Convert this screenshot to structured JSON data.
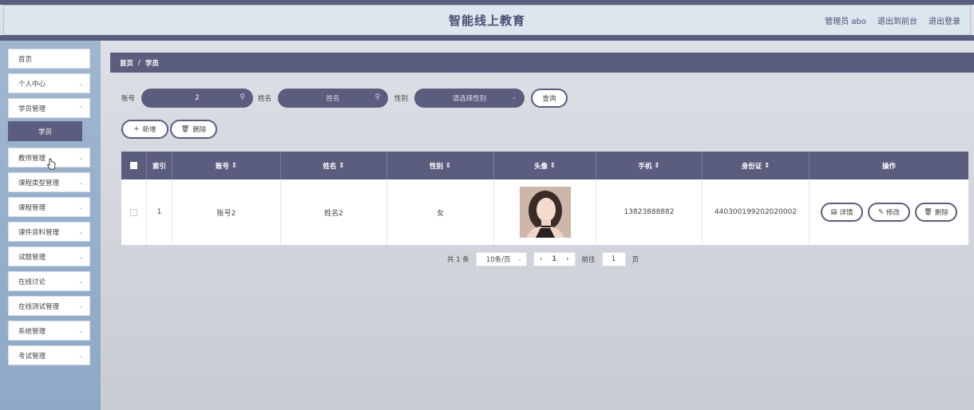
{
  "app": {
    "title": "智能线上教育",
    "user_label": "管理员 abo",
    "to_front": "退出到前台",
    "logout": "退出登录"
  },
  "sidebar": {
    "items": [
      {
        "label": "首页",
        "has_chevron": false
      },
      {
        "label": "个人中心",
        "has_chevron": true
      },
      {
        "label": "学员管理",
        "has_chevron": true
      },
      {
        "label": "教师管理",
        "has_chevron": true
      },
      {
        "label": "课程类型管理",
        "has_chevron": true
      },
      {
        "label": "课程管理",
        "has_chevron": true
      },
      {
        "label": "课件资料管理",
        "has_chevron": true
      },
      {
        "label": "试题管理",
        "has_chevron": true
      },
      {
        "label": "在线讨论",
        "has_chevron": true
      },
      {
        "label": "在线测试管理",
        "has_chevron": true
      },
      {
        "label": "系统管理",
        "has_chevron": true
      },
      {
        "label": "考试管理",
        "has_chevron": true
      }
    ],
    "sub_active": "学员"
  },
  "breadcrumb": {
    "home": "首页",
    "sep": "/",
    "current": "学员"
  },
  "search": {
    "account_label": "账号",
    "account_value": "2",
    "name_label": "姓名",
    "name_placeholder": "姓名",
    "gender_label": "性别",
    "gender_placeholder": "请选择性别",
    "query_button": "查询"
  },
  "actions": {
    "add": "新增",
    "delete": "删除"
  },
  "table": {
    "headers": [
      "索引",
      "账号",
      "姓名",
      "性别",
      "头像",
      "手机",
      "身份证",
      "操作"
    ],
    "rows": [
      {
        "index": "1",
        "account": "账号2",
        "name": "姓名2",
        "gender": "女",
        "phone": "13823888882",
        "id_card": "440300199202020002",
        "btn_detail": "详情",
        "btn_edit": "修改",
        "btn_delete": "删除"
      }
    ]
  },
  "pager": {
    "total": "共 1 条",
    "page_size": "10条/页",
    "current_page": "1",
    "goto_label": "前往",
    "goto_value": "1",
    "page_unit": "页"
  },
  "colors": {
    "accent": "#5b5d7e",
    "sidebar": "#9fb6cf",
    "header_bg": "#dbe6ef"
  }
}
